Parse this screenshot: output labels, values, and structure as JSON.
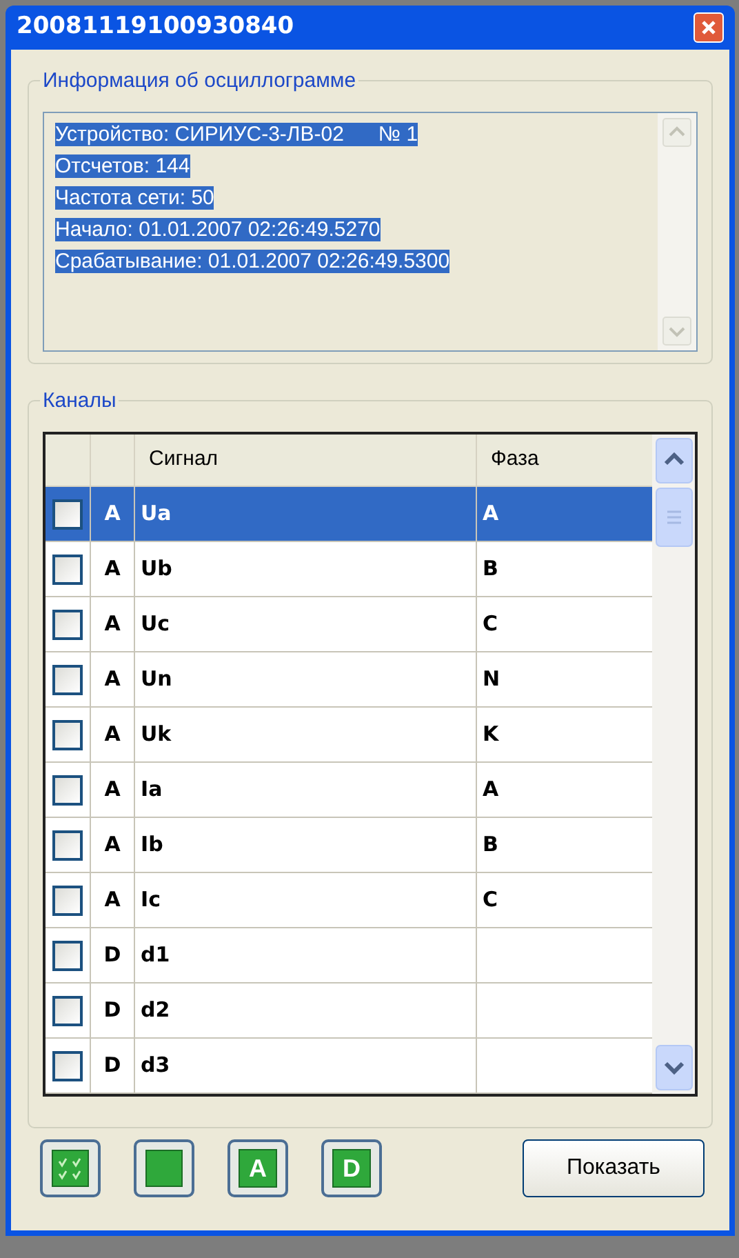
{
  "window": {
    "title": "20081119100930840"
  },
  "info": {
    "title": "Информация об осциллограмме",
    "lines": [
      "Устройство: СИРИУС-3-ЛВ-02      № 1",
      "Отсчетов: 144",
      "Частота сети: 50",
      "Начало: 01.01.2007 02:26:49.5270",
      "Срабатывание: 01.01.2007 02:26:49.5300"
    ],
    "selected": true
  },
  "channels": {
    "title": "Каналы",
    "columns": [
      "Сигнал",
      "Фаза"
    ],
    "rows": [
      {
        "checked": false,
        "selected": true,
        "type": "A",
        "signal": "Ua",
        "phase": "A"
      },
      {
        "checked": false,
        "selected": false,
        "type": "A",
        "signal": "Ub",
        "phase": "B"
      },
      {
        "checked": false,
        "selected": false,
        "type": "A",
        "signal": "Uc",
        "phase": "C"
      },
      {
        "checked": false,
        "selected": false,
        "type": "A",
        "signal": "Un",
        "phase": "N"
      },
      {
        "checked": false,
        "selected": false,
        "type": "A",
        "signal": "Uk",
        "phase": "K"
      },
      {
        "checked": false,
        "selected": false,
        "type": "A",
        "signal": "Ia",
        "phase": "A"
      },
      {
        "checked": false,
        "selected": false,
        "type": "A",
        "signal": "Ib",
        "phase": "B"
      },
      {
        "checked": false,
        "selected": false,
        "type": "A",
        "signal": "Ic",
        "phase": "C"
      },
      {
        "checked": false,
        "selected": false,
        "type": "D",
        "signal": "d1"
      },
      {
        "checked": false,
        "selected": false,
        "type": "D",
        "signal": "d2"
      },
      {
        "checked": false,
        "selected": false,
        "type": "D",
        "signal": "d3"
      }
    ]
  },
  "tool_buttons": [
    {
      "kind": "check_all"
    },
    {
      "kind": "clear"
    },
    {
      "kind": "letter",
      "label": "A"
    },
    {
      "kind": "letter",
      "label": "D"
    }
  ],
  "show_button": "Показать"
}
